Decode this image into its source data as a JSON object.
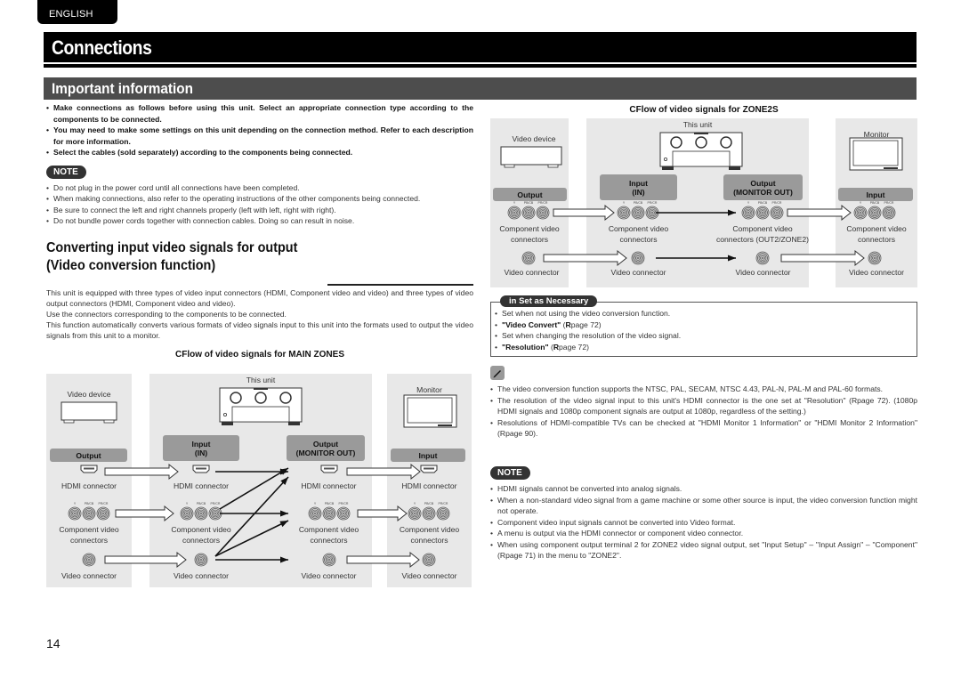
{
  "header": {
    "language_tab": "ENGLISH",
    "title": "Connections",
    "section_title": "Important information"
  },
  "intro_bullets": [
    "Make connections as follows before using this unit. Select an appropriate connection type according to the components to be connected.",
    "You may need to make some settings on this unit depending on the connection method. Refer to each description for more information.",
    "Select the cables (sold separately) according to the components being connected."
  ],
  "note1": {
    "label": "NOTE",
    "items": [
      "Do not plug in the power cord until all connections have been completed.",
      "When making connections, also refer to the operating instructions of the other components being connected.",
      "Be sure to connect the left and right channels properly (left with left, right with right).",
      "Do not bundle power cords together with connection cables. Doing so can result in noise."
    ]
  },
  "conversion": {
    "title_line1": "Converting input video signals for output",
    "title_line2": "(Video conversion function)",
    "paragraphs": [
      "This unit is equipped with three types of video input connectors (HDMI, Component video and video) and three types of video output connectors (HDMI, Component video and video).",
      "Use the connectors corresponding to the components to be connected.",
      "This function automatically converts various formats of video signals input to this unit into the formats used to output the video signals from this unit to a monitor."
    ]
  },
  "main_flow": {
    "title": "CFlow of video signals for MAIN ZONES",
    "video_device": "Video device",
    "this_unit": "This unit",
    "monitor": "Monitor",
    "output_hdr": "Output",
    "input_hdr_l1": "Input",
    "input_hdr_l2": "(IN)",
    "out_hdr_l1": "Output",
    "out_hdr_l2": "(MONITOR OUT)",
    "monitor_input_hdr": "Input",
    "hdmi": "HDMI connector",
    "comp_l1": "Component video",
    "comp_l2": "connectors",
    "video": "Video connector",
    "comp_pins": [
      "Y",
      "PB/CB",
      "PR/CR"
    ],
    "internal_routes": [
      {
        "from": "HDMI",
        "to": "HDMI"
      },
      {
        "from": "Component",
        "to": "HDMI"
      },
      {
        "from": "Component",
        "to": "Component"
      },
      {
        "from": "Video",
        "to": "HDMI"
      },
      {
        "from": "Video",
        "to": "Component"
      },
      {
        "from": "Video",
        "to": "Video"
      }
    ]
  },
  "zone2_flow": {
    "title": "CFlow of video signals for ZONE2S",
    "video_device": "Video device",
    "this_unit": "This unit",
    "monitor": "Monitor",
    "output_hdr": "Output",
    "input_hdr_l1": "Input",
    "input_hdr_l2": "(IN)",
    "out_hdr_l1": "Output",
    "out_hdr_l2": "(MONITOR OUT)",
    "monitor_input_hdr": "Input",
    "comp_l1": "Component video",
    "comp_l2": "connectors",
    "comp_out_l2": "connectors (OUT2/ZONE2)",
    "video": "Video connector"
  },
  "set_as_necessary": {
    "label": "in Set as Necessary",
    "items": [
      {
        "text": "Set when not using the video conversion function.",
        "setting": "\"Video Convert\"",
        "ref_prefix": "R",
        "ref": "page 72"
      },
      {
        "text": "Set when changing the resolution of the video signal.",
        "setting": "\"Resolution\"",
        "ref_prefix": "R",
        "ref": "page 72"
      }
    ]
  },
  "tips": [
    "The video conversion function supports the NTSC, PAL, SECAM, NTSC 4.43, PAL-N, PAL-M and PAL-60 formats.",
    "The resolution of the video signal input to this unit's HDMI connector is the one set at \"Resolution\" (Rpage 72). (1080p HDMI signals and 1080p component signals are output at 1080p, regardless of the setting.)",
    "Resolutions of HDMI-compatible TVs can be checked at \"HDMI Monitor 1 Information\" or \"HDMI Monitor 2 Information\" (Rpage 90)."
  ],
  "note2": {
    "label": "NOTE",
    "items": [
      "HDMI signals cannot be converted into analog signals.",
      "When a non-standard video signal from a game machine or some other source is input, the video conversion function might not operate.",
      "Component video input signals cannot be converted into Video format.",
      "A menu is output via the HDMI connector or component video connector.",
      "When using component output terminal 2 for ZONE2 video signal output, set \"Input Setup\" – \"Input Assign\" – \"Component\" (Rpage 71) in the menu to \"ZONE2\"."
    ]
  },
  "page_number": "14",
  "colors": {
    "title_bar": "#000000",
    "section_bar": "#4d4d4d",
    "panel": "#e8e8e8",
    "panel_header": "#9a9a9a"
  }
}
